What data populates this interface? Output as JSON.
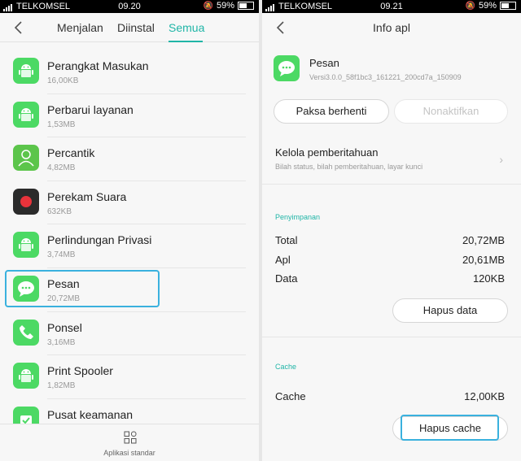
{
  "left": {
    "status": {
      "carrier": "TELKOMSEL",
      "time": "09.20",
      "battery": "59%",
      "battery_level": 0.59
    },
    "tabs": [
      {
        "label": "Menjalan"
      },
      {
        "label": "Diinstal"
      },
      {
        "label": "Semua"
      }
    ],
    "active_tab": "Semua",
    "apps": [
      {
        "name": "Perangkat Masukan",
        "size": "16,00KB",
        "icon": "android-icon",
        "color": "#4cd964"
      },
      {
        "name": "Perbarui layanan",
        "size": "1,53MB",
        "icon": "android-icon",
        "color": "#4cd964"
      },
      {
        "name": "Percantik",
        "size": "4,82MB",
        "icon": "person-icon",
        "color": "#5cc54b"
      },
      {
        "name": "Perekam Suara",
        "size": "632KB",
        "icon": "record-icon",
        "color": "#2b2b2b"
      },
      {
        "name": "Perlindungan Privasi",
        "size": "3,74MB",
        "icon": "android-icon",
        "color": "#4cd964"
      },
      {
        "name": "Pesan",
        "size": "20,72MB",
        "icon": "chat-icon",
        "color": "#4cd964"
      },
      {
        "name": "Ponsel",
        "size": "3,16MB",
        "icon": "phone-icon",
        "color": "#4cd964"
      },
      {
        "name": "Print Spooler",
        "size": "1,82MB",
        "icon": "android-icon",
        "color": "#4cd964"
      },
      {
        "name": "Pusat keamanan",
        "size": "",
        "icon": "shield-icon",
        "color": "#4cd964"
      }
    ],
    "bottom_label": "Aplikasi standar"
  },
  "right": {
    "status": {
      "carrier": "TELKOMSEL",
      "time": "09.21",
      "battery": "59%",
      "battery_level": 0.59
    },
    "title": "Info apl",
    "app_name": "Pesan",
    "version": "Versi3.0.0_58f1bc3_161221_200cd7a_150909",
    "force_stop": "Paksa berhenti",
    "disable": "Nonaktifkan",
    "notif_title": "Kelola pemberitahuan",
    "notif_sub": "Bilah status, bilah pemberitahuan, layar kunci",
    "storage_label": "Penyimpanan",
    "storage": [
      {
        "k": "Total",
        "v": "20,72MB"
      },
      {
        "k": "Apl",
        "v": "20,61MB"
      },
      {
        "k": "Data",
        "v": "120KB"
      }
    ],
    "clear_data": "Hapus data",
    "cache_label": "Cache",
    "cache_key": "Cache",
    "cache_value": "12,00KB",
    "clear_cache": "Hapus cache"
  }
}
